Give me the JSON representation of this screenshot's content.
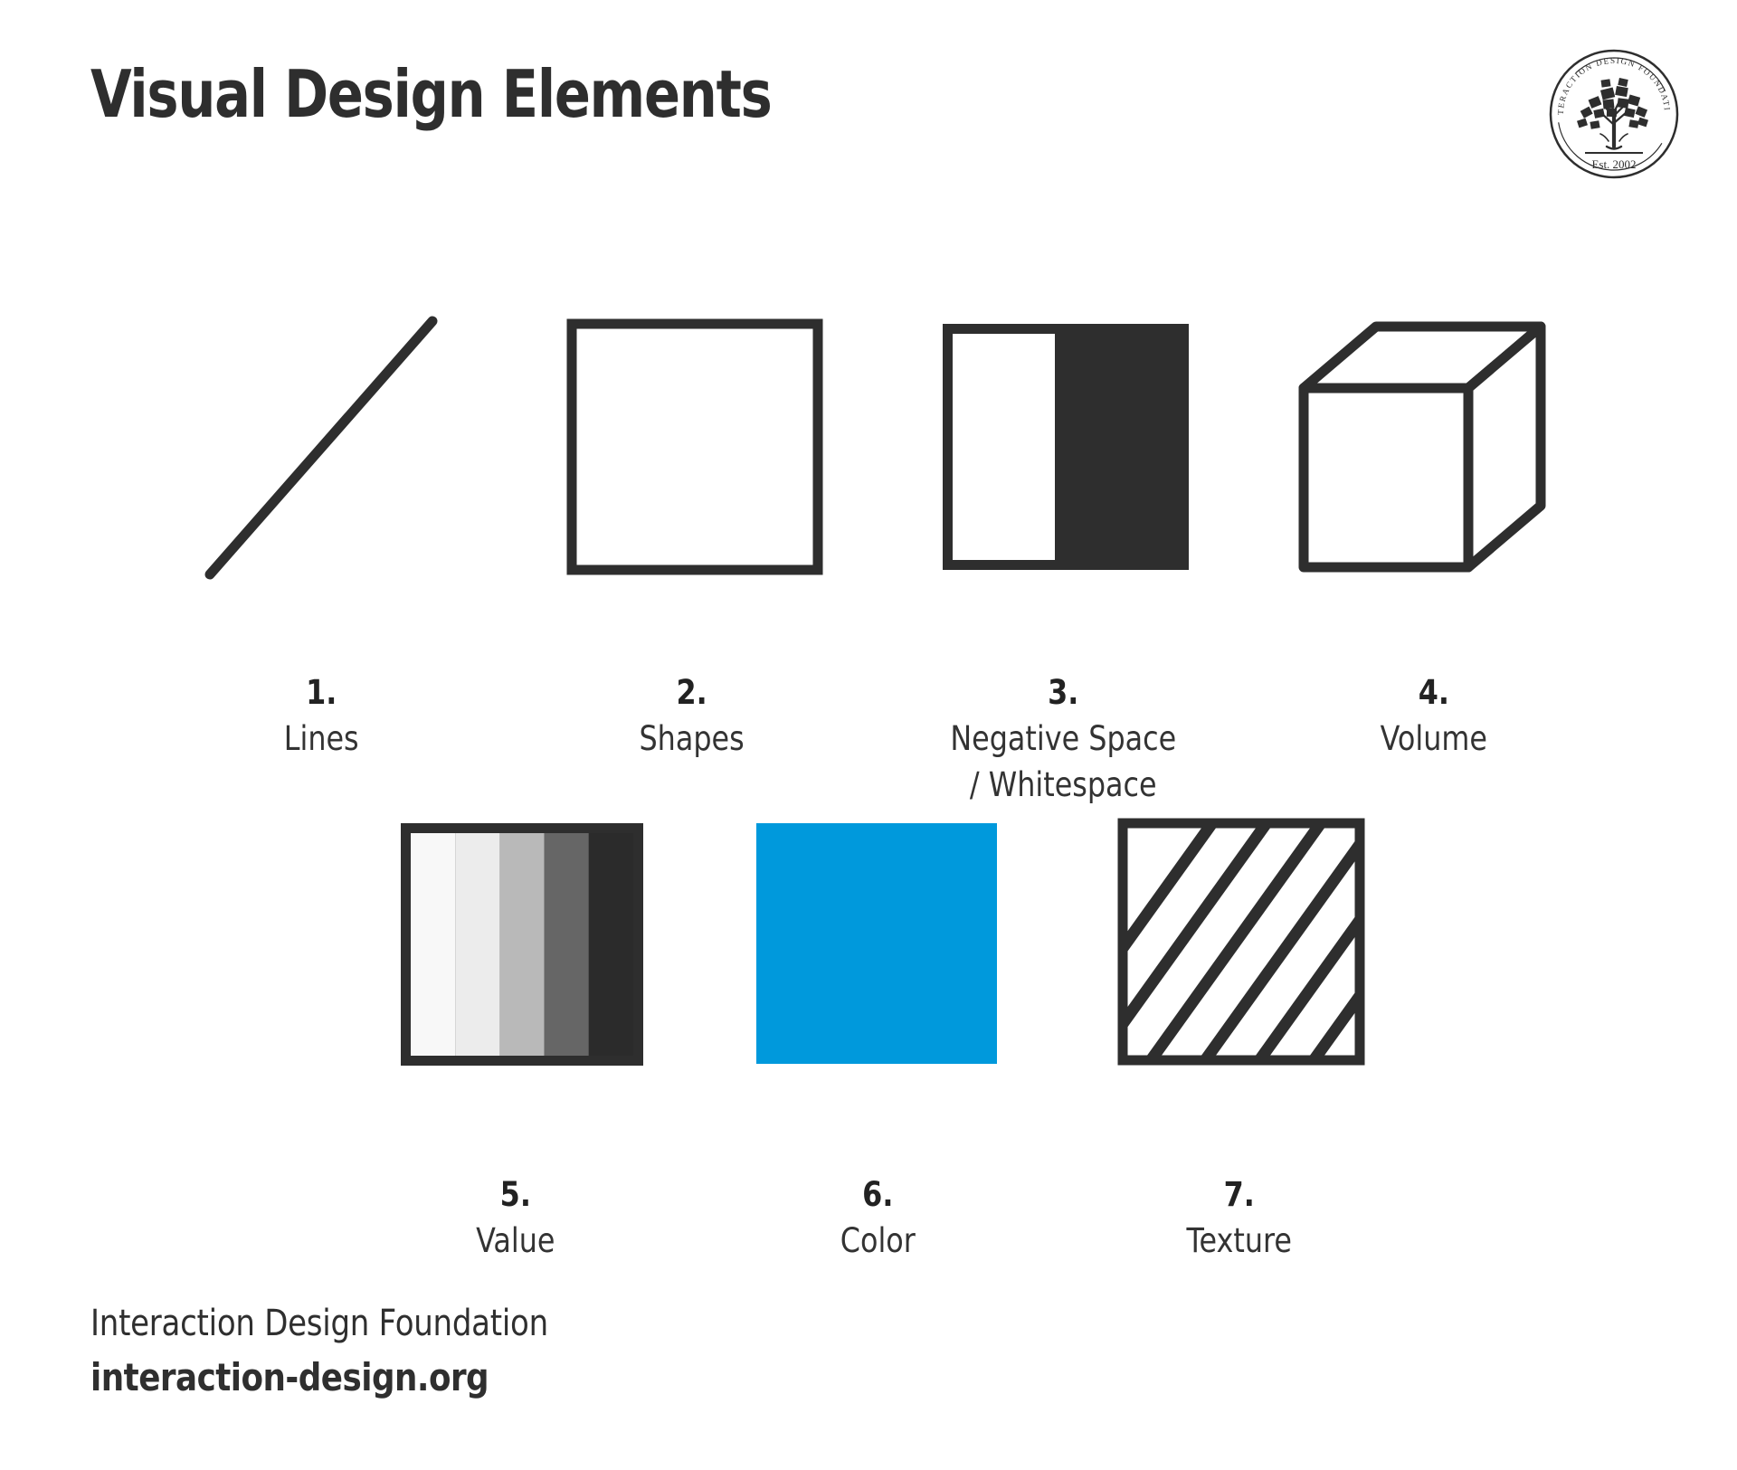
{
  "header": {
    "title": "Visual Design Elements",
    "logo": {
      "name": "idf-logo",
      "arc_text": "INTERACTION DESIGN FOUNDATION",
      "established": "Est. 2002"
    }
  },
  "elements": [
    {
      "number": "1.",
      "label": "Lines",
      "art": "diagonal-line"
    },
    {
      "number": "2.",
      "label": "Shapes",
      "art": "square-outline"
    },
    {
      "number": "3.",
      "label": "Negative Space\n/ Whitespace",
      "art": "negative-space-square"
    },
    {
      "number": "4.",
      "label": "Volume",
      "art": "cube"
    },
    {
      "number": "5.",
      "label": "Value",
      "art": "value-scale"
    },
    {
      "number": "6.",
      "label": "Color",
      "art": "color-swatch"
    },
    {
      "number": "7.",
      "label": "Texture",
      "art": "texture-hatch"
    }
  ],
  "value_scale": {
    "bands": [
      "#f8f8f8",
      "#ececec",
      "#b9b9b9",
      "#666666",
      "#2b2b2b"
    ],
    "frame": "#2e2e2e"
  },
  "colors": {
    "ink": "#2e2e2e",
    "text": "#333333",
    "accent_blue": "#0099dc",
    "background": "#ffffff"
  },
  "footer": {
    "org_name": "Interaction Design Foundation",
    "org_url": "interaction-design.org"
  }
}
